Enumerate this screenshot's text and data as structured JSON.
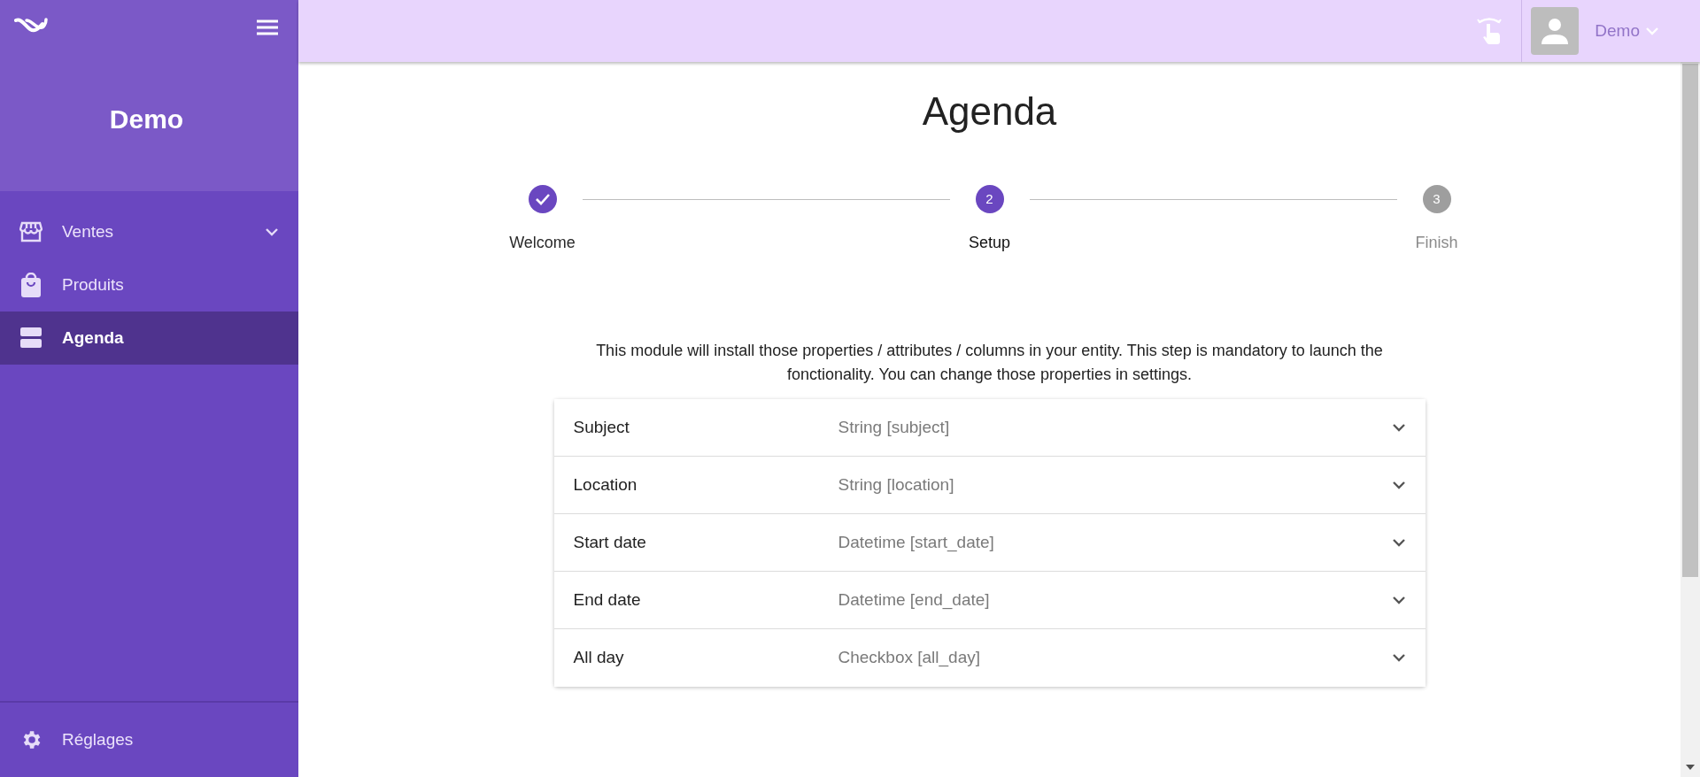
{
  "sidebar": {
    "title": "Demo",
    "items": [
      {
        "label": "Ventes",
        "has_submenu": true,
        "expanded": false,
        "selected": false
      },
      {
        "label": "Produits",
        "has_submenu": false,
        "selected": false
      },
      {
        "label": "Agenda",
        "has_submenu": false,
        "selected": true
      }
    ],
    "footer_item": {
      "label": "Réglages"
    }
  },
  "header": {
    "user": "Demo"
  },
  "page": {
    "title": "Agenda",
    "steps": [
      {
        "label": "Welcome",
        "completed": true,
        "selected": false
      },
      {
        "label": "Setup",
        "number": "2",
        "completed": false,
        "selected": true
      },
      {
        "label": "Finish",
        "number": "3",
        "completed": false,
        "selected": false
      }
    ],
    "description": "This module will install those properties / attributes / columns in your entity. This step is mandatory to launch the fonctionality. You can change those properties in settings.",
    "properties": [
      {
        "name": "Subject",
        "type": "String [subject]",
        "expanded": false
      },
      {
        "name": "Location",
        "type": "String [location]",
        "expanded": false
      },
      {
        "name": "Start date",
        "type": "Datetime [start_date]",
        "expanded": false
      },
      {
        "name": "End date",
        "type": "Datetime [end_date]",
        "expanded": false
      },
      {
        "name": "All day",
        "type": "Checkbox [all_day]",
        "expanded": false
      }
    ]
  }
}
